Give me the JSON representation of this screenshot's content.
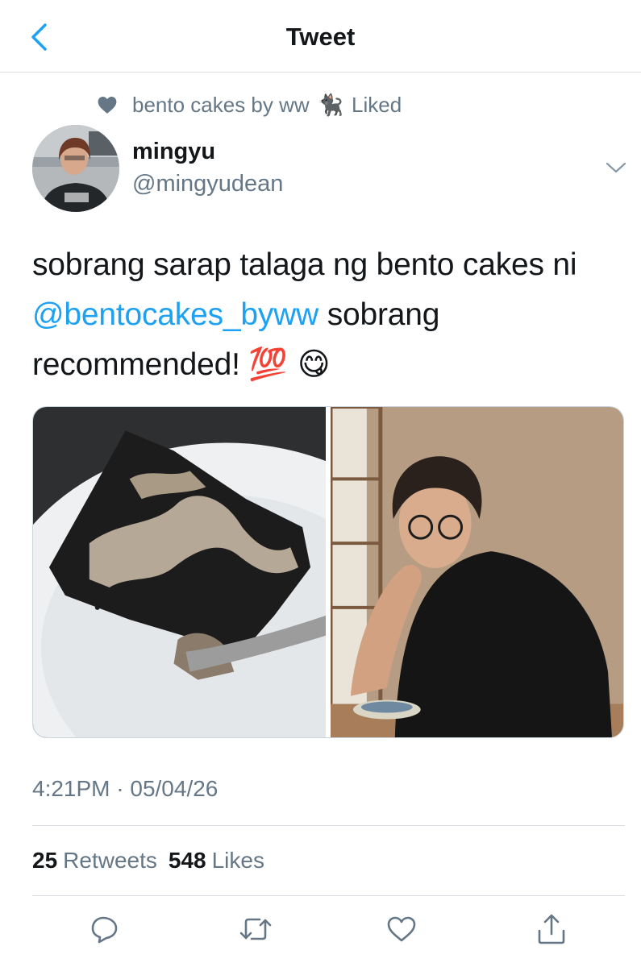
{
  "header": {
    "title": "Tweet",
    "back_icon": "chevron-left-icon"
  },
  "social_context": {
    "icon": "heart-icon",
    "text": "bento cakes by ww",
    "emoji": "🐈‍⬛",
    "suffix": "Liked"
  },
  "tweet": {
    "author": {
      "display_name": "mingyu",
      "handle": "@mingyudean"
    },
    "text_parts": {
      "before_mention": "sobrang sarap talaga ng bento cakes ni ",
      "mention": "@bentocakes_byww",
      "after_mention": " sobrang recommended! ",
      "emojis": "💯 😋"
    },
    "media": [
      {
        "alt": "chocolate cake slice on a plate"
      },
      {
        "alt": "man in black shirt seated at a table"
      }
    ],
    "timestamp": "4:21PM · 05/04/26",
    "stats": {
      "retweets_count": "25",
      "retweets_label": "Retweets",
      "likes_count": "548",
      "likes_label": "Likes"
    }
  },
  "actions": [
    {
      "name": "reply",
      "icon": "reply-icon"
    },
    {
      "name": "retweet",
      "icon": "retweet-icon"
    },
    {
      "name": "like",
      "icon": "heart-outline-icon"
    },
    {
      "name": "share",
      "icon": "share-icon"
    }
  ],
  "colors": {
    "accent": "#1da1f2",
    "secondary_text": "#657786",
    "primary_text": "#14171a",
    "divider": "#d9dde1"
  }
}
